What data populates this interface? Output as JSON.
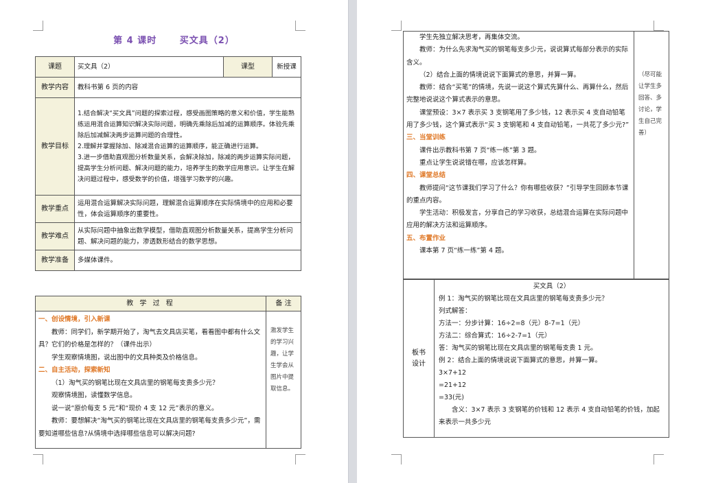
{
  "left_page": {
    "title": {
      "lesson": "第 4 课时",
      "name": "买文具（2）"
    },
    "info_table": {
      "topic_label": "课题",
      "topic": "买文具（2）",
      "type_label": "课型",
      "type": "新授课",
      "content_label": "教学内容",
      "content": "教科书第 6 页的内容",
      "goals_label": "教学目标",
      "goals": [
        "1.结合解决“买文具”问题的探索过程，感受画图策略的意义和价值，学生能熟练运用混合运算知识解决实际问题，明确先乘除后加减的运算顺序。体验先乘除后加减解决两步运算问题的合理性。",
        "2.理解并掌握除加、除减混合运算的运算顺序，能正确进行运算。",
        "3.进一步借助直观图分析数量关系，会解决除加，除减的两步运算实际问题，提高学生分析问题、解决问题的能力，培养学生的数学应用意识。让学生在解决问题过程中，感受数学的价值，增强学习数学的兴趣。"
      ],
      "key_label": "教学重点",
      "key": "运用混合运算解决实际问题，理解混合运算顺序在实际情境中的应用和必要性，体会运算顺序的重要性。",
      "difficulty_label": "教学难点",
      "difficulty": "从实际问题中抽象出数学模型，借助直观图分析数量关系，提高学生分析问题、解决问题的能力，渗透数形结合的数学思想。",
      "prep_label": "教学准备",
      "prep": "多媒体课件。"
    },
    "process_table": {
      "header_process": "教 学 过 程",
      "header_note": "备 注",
      "section1": "一、创设情境，引入新课",
      "p1": "教师：同学们，新学期开始了，淘气去文具店买笔，看看图中都有什么文具？它们的价格是怎样的？（课件出示）",
      "p2": "学生观察情境图，说出图中的文具种类及价格信息。",
      "section2": "二、自主活动，探索新知",
      "p3": "（1）淘气买的钢笔比现在文具店里的钢笔每支贵多少元？",
      "p4": "观察情境图，读懂数学信息。",
      "p5": "说一说“原价每支 5 元”和“现价 4 支 12 元”表示的意义。",
      "p6": "教师：要想解决“淘气买的钢笔比现在文具店里的钢笔每支贵多少元”，需要知道哪些信息?从情境中选择哪些信息可以解决问题?",
      "note": "激发学生的学习兴趣，让学生学会从图片中提取信息。"
    }
  },
  "right_page": {
    "continuation": {
      "p1": "学生先独立解决思考，再集体交流。",
      "p2": "教师：为什么先求淘气买的钢笔每支多少元，说说算式每部分表示的实际含义。",
      "p3": "（2）结合上面的情境说说下面算式的意思，并算一算。",
      "p4": "教师：结合“买笔”的情境，先说一说这个算式先算什么、再算什么，然后完整地说说这个算式表示的意思。",
      "p5": "课堂预设：3×7 表示买 3 支钢笔用了多少钱，12 表示买 4 支自动铅笔用了多少钱，这个算式表示“买 3 支钢笔和 4 支自动铅笔，一共花了多少元?”",
      "section3": "三、当堂训练",
      "p6": "课件出示教科书第 7 页“练一练”第 3 题。",
      "p7": "重点让学生说说错在哪，应该怎样算。",
      "section4": "四、课堂总结",
      "p8": "教师提问“这节课我们学习了什么？你有哪些收获？”引导学生回顾本节课的重点内容。",
      "p9": "学生活动：积极发言，分享自己的学习收获，总结混合运算在实际问题中应用的解决方法和运算顺序。",
      "section5": "五、布置作业",
      "p10": "课本第 7 页“练一练”第 4 题。",
      "note": "（尽可能让学生多回答、多讨论，学生自己完善）"
    },
    "board": {
      "label_line1": "板书",
      "label_line2": "设计",
      "title": "买文具（2）",
      "l1": "例 1：淘气买的钢笔比现在文具店里的钢笔每支贵多少元？",
      "l2": "列式解答：",
      "l3": "方法一：分步计算：16÷2=8（元）8-7=1（元）",
      "l4": "方法二：综合算式：16÷2-7=1（元）",
      "l5": "答：淘气买的钢笔比现在文具店里的钢笔每支贵 1 元。",
      "l6": "例 2：结合上面的情境说说下面算式的意思，并算一算。",
      "l7": "3×7+12",
      "l8": "=21+12",
      "l9": "=33(元)",
      "l10": "含义：3×7 表示 3 支钢笔的价钱和 12 表示 4 支自动铅笔的价钱，加起来表示一共多少元"
    }
  }
}
